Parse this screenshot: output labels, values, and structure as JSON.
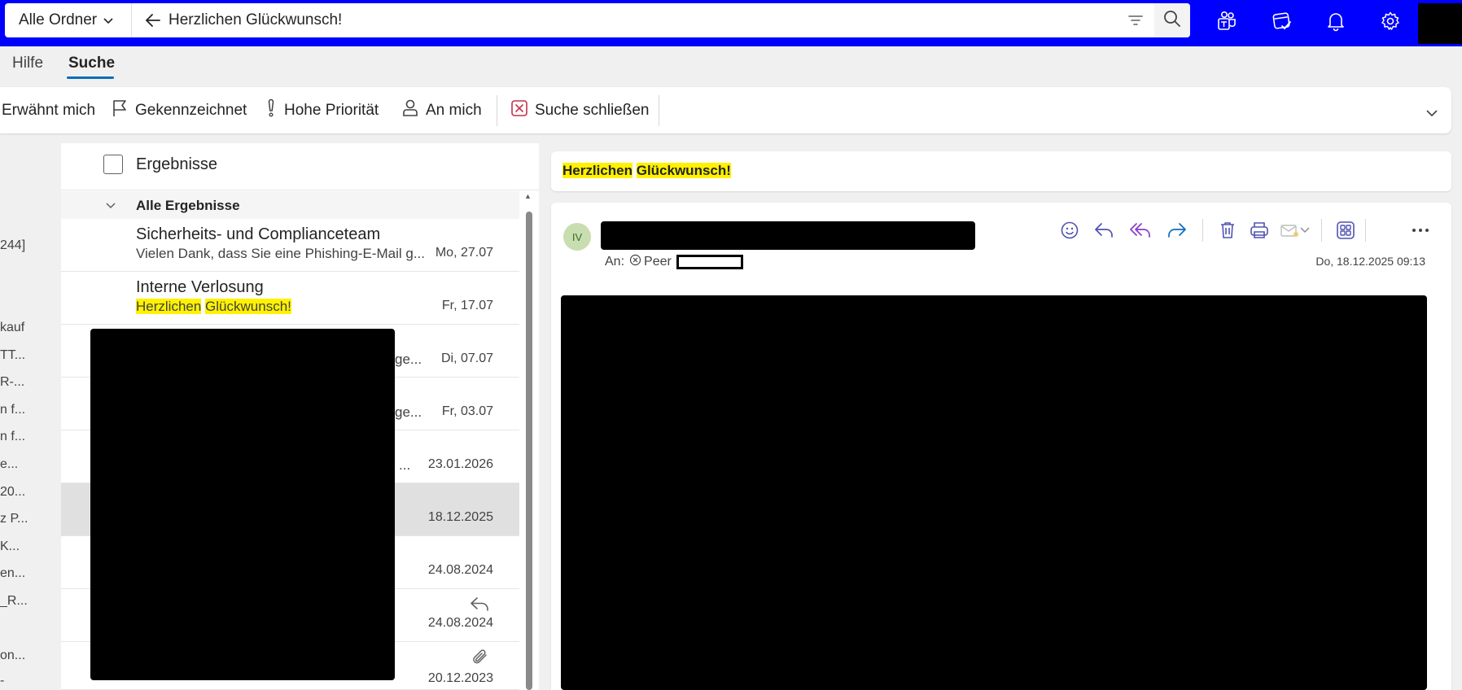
{
  "search": {
    "scope_label": "Alle Ordner",
    "query": "Herzlichen Glückwunsch!"
  },
  "tabs": [
    {
      "label": "Hilfe"
    },
    {
      "label": "Suche"
    }
  ],
  "toolbar": {
    "mentions_me": "Erwähnt mich",
    "flagged": "Gekennzeichnet",
    "high_priority": "Hohe Priorität",
    "to_me": "An mich",
    "close_search": "Suche schließen"
  },
  "folders": [
    "244]",
    "kauf",
    "TT...",
    "R-...",
    "n f...",
    "n f...",
    "e...",
    "20...",
    "z P...",
    "K...",
    "en...",
    "_R...",
    "on...",
    "-"
  ],
  "list": {
    "results_label": "Ergebnisse",
    "group_label": "Alle Ergebnisse",
    "rows": [
      {
        "sender": "Sicherheits- und Complianceteam",
        "preview": "Vielen Dank, dass Sie eine Phishing-E-Mail g...",
        "date": "Mo, 27.07"
      },
      {
        "sender": "Interne Verlosung",
        "preview_hl_1": "Herzlichen",
        "preview_hl_2": "Glückwunsch!",
        "date": "Fr, 17.07"
      },
      {
        "preview": "ge...",
        "date": "Di, 07.07"
      },
      {
        "preview": "ge...",
        "date": "Fr, 03.07"
      },
      {
        "preview": "...",
        "date": "23.01.2026"
      },
      {
        "date": "18.12.2025"
      },
      {
        "date": "24.08.2024"
      },
      {
        "date": "24.08.2024"
      },
      {
        "date": "20.12.2023"
      }
    ]
  },
  "reading": {
    "subject_word_1": "Herzlichen",
    "subject_word_2": "Glückwunsch!",
    "avatar_initials": "IV",
    "to_label": "An:",
    "recipient": "Peer",
    "date": "Do, 18.12.2025 09:13"
  },
  "colors": {
    "topbar": "#0000ff",
    "accent": "#0f6cbd",
    "highlight": "#fff100",
    "reply_all": "#8a3cc7",
    "forward": "#0f6cbd"
  }
}
